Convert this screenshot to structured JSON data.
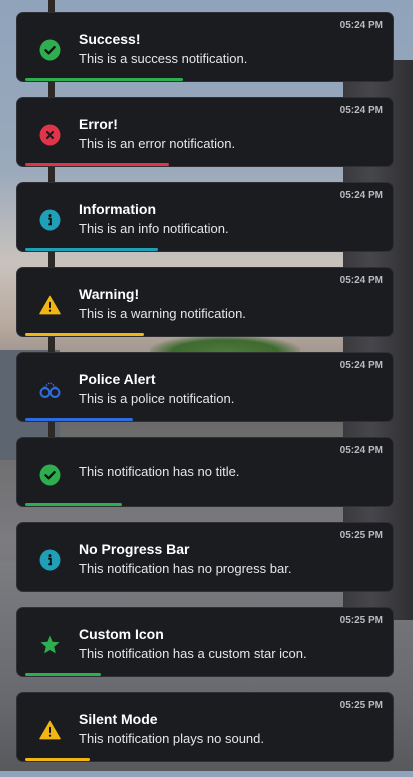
{
  "notifications": [
    {
      "type": "success",
      "title": "Success!",
      "message": "This is a success notification.",
      "time": "05:24 PM",
      "icon": "check-circle-icon",
      "color": "#2fae4f",
      "progress": 0.44
    },
    {
      "type": "error",
      "title": "Error!",
      "message": "This is an error notification.",
      "time": "05:24 PM",
      "icon": "x-circle-icon",
      "color": "#e0344a",
      "progress": 0.4
    },
    {
      "type": "info",
      "title": "Information",
      "message": "This is an info notification.",
      "time": "05:24 PM",
      "icon": "info-circle-icon",
      "color": "#1fa0b8",
      "progress": 0.37
    },
    {
      "type": "warning",
      "title": "Warning!",
      "message": "This is a warning notification.",
      "time": "05:24 PM",
      "icon": "warning-triangle-icon",
      "color": "#f2b614",
      "progress": 0.33
    },
    {
      "type": "police",
      "title": "Police Alert",
      "message": "This is a police notification.",
      "time": "05:24 PM",
      "icon": "handcuffs-icon",
      "color": "#2f6be0",
      "progress": 0.3
    },
    {
      "type": "success",
      "title": "",
      "message": "This notification has no title.",
      "time": "05:24 PM",
      "icon": "check-circle-icon",
      "color": "#2fae4f",
      "progress": 0.27
    },
    {
      "type": "info",
      "title": "No Progress Bar",
      "message": "This notification has no progress bar.",
      "time": "05:25 PM",
      "icon": "info-circle-icon",
      "color": "#1fa0b8",
      "progress": null
    },
    {
      "type": "custom",
      "title": "Custom Icon",
      "message": "This notification has a custom star icon.",
      "time": "05:25 PM",
      "icon": "star-icon",
      "color": "#2fae4f",
      "progress": 0.21
    },
    {
      "type": "warning",
      "title": "Silent Mode",
      "message": "This notification plays no sound.",
      "time": "05:25 PM",
      "icon": "warning-triangle-icon",
      "color": "#f2b614",
      "progress": 0.18
    }
  ]
}
